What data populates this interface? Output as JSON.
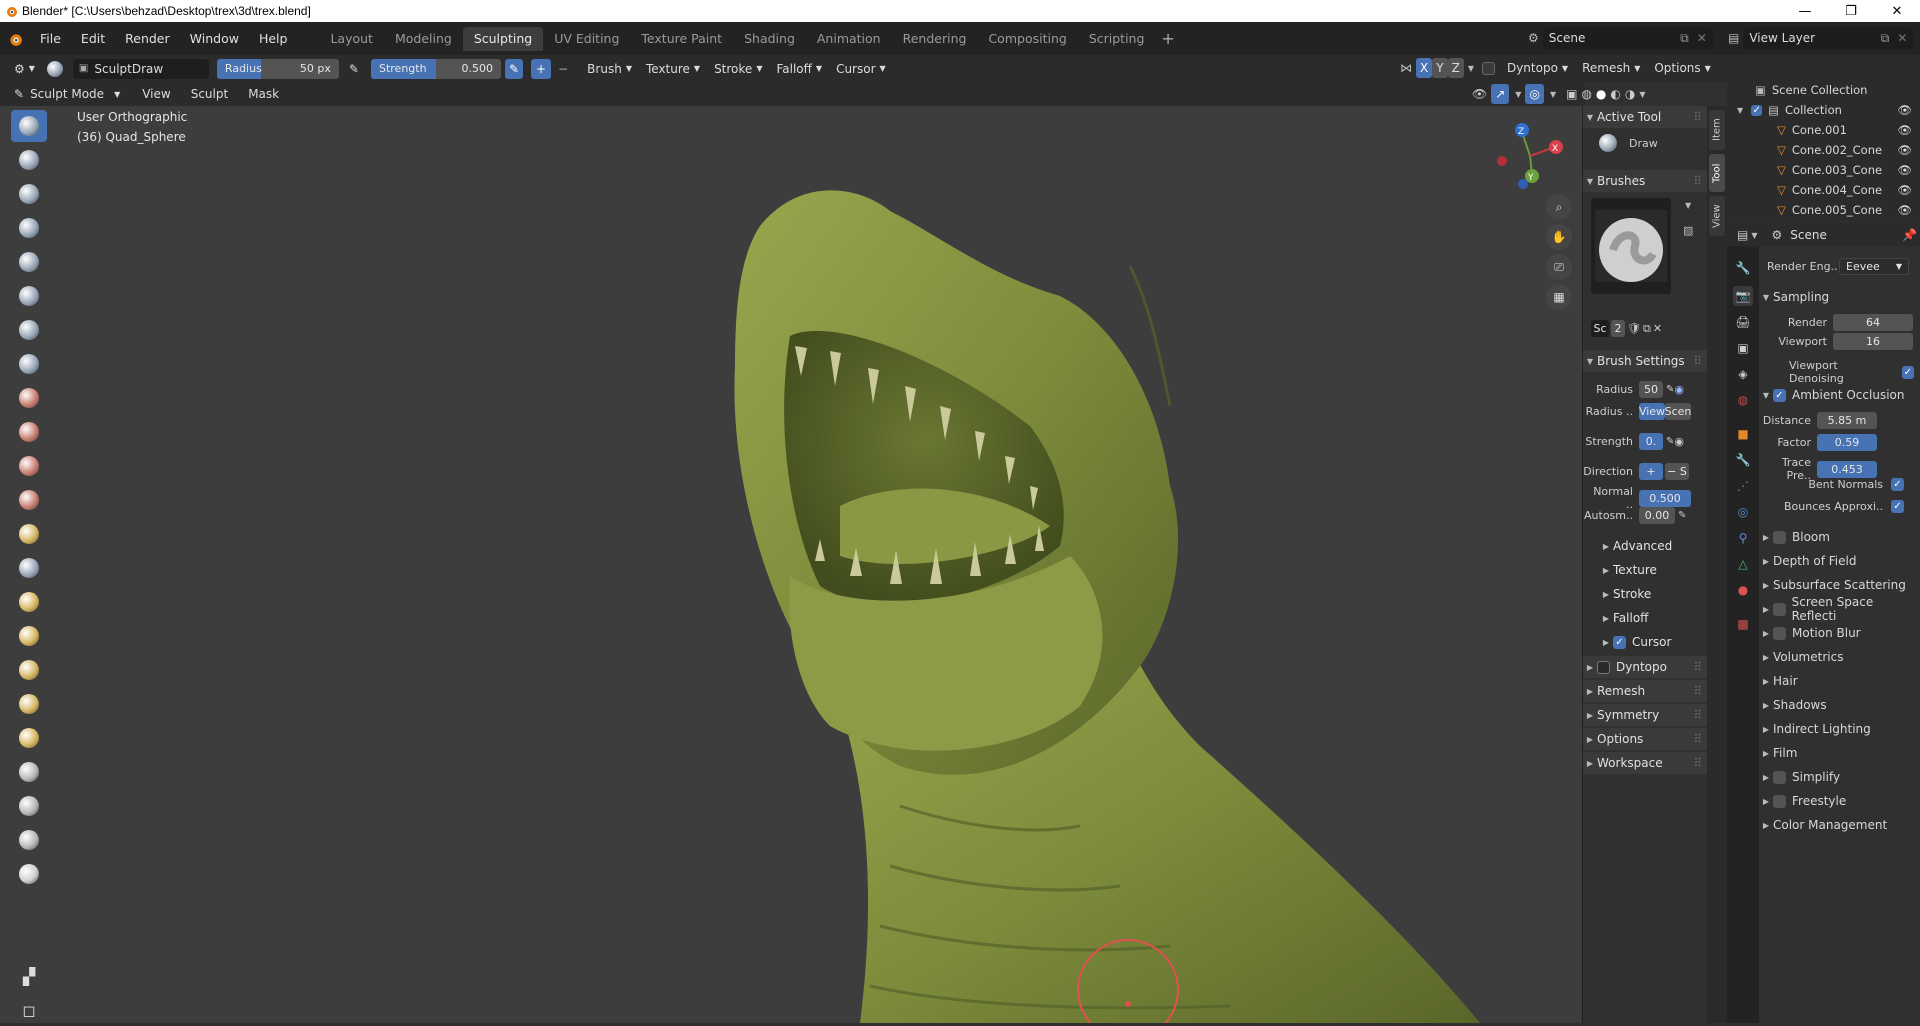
{
  "window": {
    "title": "Blender* [C:\\Users\\behzad\\Desktop\\trex\\3d\\trex.blend]"
  },
  "menu": [
    "File",
    "Edit",
    "Render",
    "Window",
    "Help"
  ],
  "workspaces": [
    "Layout",
    "Modeling",
    "Sculpting",
    "UV Editing",
    "Texture Paint",
    "Shading",
    "Animation",
    "Rendering",
    "Compositing",
    "Scripting"
  ],
  "scene_field": "Scene",
  "view_layer_field": "View Layer",
  "tool_header": {
    "brush_name": "SculptDraw",
    "radius_label": "Radius",
    "radius_value": "50 px",
    "strength_label": "Strength",
    "strength_value": "0.500",
    "menus": [
      "Brush",
      "Texture",
      "Stroke",
      "Falloff",
      "Cursor"
    ],
    "axes": [
      "X",
      "Y",
      "Z"
    ],
    "dyntopo": "Dyntopo",
    "remesh": "Remesh",
    "options": "Options"
  },
  "mode_header": {
    "mode": "Sculpt Mode",
    "menus": [
      "View",
      "Sculpt",
      "Mask"
    ]
  },
  "viewport": {
    "view_name": "User Orthographic",
    "object_info": "(36) Quad_Sphere",
    "gizmo_axes": [
      "Z",
      "X",
      "Y"
    ]
  },
  "npanel": {
    "tabs": [
      "Item",
      "Tool",
      "View"
    ],
    "active_tool_header": "Active Tool",
    "active_tool_name": "Draw",
    "brushes_header": "Brushes",
    "brush_datablock": {
      "short_name": "Sc",
      "users": "2"
    },
    "brush_settings_header": "Brush Settings",
    "radius_label": "Radius",
    "radius_value": "50",
    "radius_unit_label": "Radius ..",
    "radius_unit_view": "View",
    "radius_unit_scene": "Scen",
    "strength_label": "Strength",
    "strength_value": "0.",
    "direction_label": "Direction",
    "direction_plus": "+",
    "direction_minus": "− S",
    "normal_label": "Normal ..",
    "normal_value": "0.500",
    "autosmooth_label": "Autosm..",
    "autosmooth_value": "0.00",
    "subsections": [
      "Advanced",
      "Texture",
      "Stroke",
      "Falloff",
      "Cursor"
    ],
    "sections": [
      "Dyntopo",
      "Remesh",
      "Symmetry",
      "Options",
      "Workspace"
    ]
  },
  "outliner": {
    "root": "Scene Collection",
    "collection": "Collection",
    "items": [
      "Cone.001",
      "Cone.002_Cone",
      "Cone.003_Cone",
      "Cone.004_Cone",
      "Cone.005_Cone"
    ]
  },
  "properties": {
    "context": "Scene",
    "render_engine_label": "Render Eng..",
    "render_engine_value": "Eevee",
    "sampling": "Sampling",
    "render_label": "Render",
    "render_value": "64",
    "viewport_label": "Viewport",
    "viewport_value": "16",
    "viewport_denoising": "Viewport Denoising",
    "ambient_occlusion": "Ambient Occlusion",
    "distance_label": "Distance",
    "distance_value": "5.85 m",
    "factor_label": "Factor",
    "factor_value": "0.59",
    "trace_label": "Trace Pre..",
    "trace_value": "0.453",
    "bent_normals": "Bent Normals",
    "bounces": "Bounces Approxi..",
    "panels": [
      "Bloom",
      "Depth of Field",
      "Subsurface Scattering",
      "Screen Space Reflecti",
      "Motion Blur",
      "Volumetrics",
      "Hair",
      "Shadows",
      "Indirect Lighting",
      "Film",
      "Simplify",
      "Freestyle",
      "Color Management"
    ]
  },
  "colors": {
    "accent": "#4772b3",
    "model": "#7b8a3a",
    "brush_circle": "#e35050"
  }
}
